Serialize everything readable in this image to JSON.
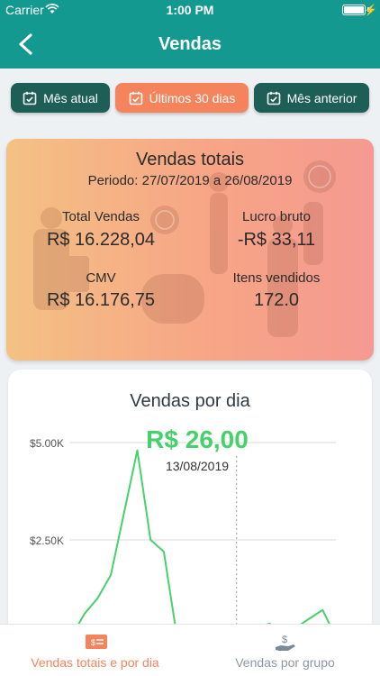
{
  "status_bar": {
    "carrier": "Carrier",
    "time": "1:00 PM"
  },
  "nav": {
    "title": "Vendas"
  },
  "filters": [
    {
      "label": "Mês atual",
      "active": false
    },
    {
      "label": "Últimos 30 dias",
      "active": true
    },
    {
      "label": "Mês anterior",
      "active": false
    }
  ],
  "summary": {
    "title": "Vendas totais",
    "period": "Periodo: 27/07/2019 a 26/08/2019",
    "total_vendas_label": "Total Vendas",
    "total_vendas_value": "R$ 16.228,04",
    "lucro_bruto_label": "Lucro bruto",
    "lucro_bruto_value": "-R$ 33,11",
    "cmv_label": "CMV",
    "cmv_value": "R$ 16.176,75",
    "itens_label": "Itens vendidos",
    "itens_value": "172.0"
  },
  "chart": {
    "title": "Vendas por dia",
    "highlight_value": "R$ 26,00",
    "highlight_date": "13/08/2019",
    "y_ticks": [
      "$5.00K",
      "$2.50K"
    ]
  },
  "chart_data": {
    "type": "line",
    "title": "Vendas por dia",
    "xlabel": "",
    "ylabel": "",
    "ylim": [
      0,
      6000
    ],
    "y_tick_values": [
      5000,
      2500
    ],
    "series": [
      {
        "values": [
          0,
          600,
          1000,
          1600,
          3200,
          4800,
          2500,
          2200,
          0,
          null,
          null,
          null,
          null,
          0,
          250,
          350,
          120,
          250,
          480,
          700,
          0
        ]
      }
    ],
    "highlight_index": 13,
    "grid": true,
    "line_color": "#47d16a"
  },
  "tabs": [
    {
      "label": "Vendas totais e por dia",
      "active": true
    },
    {
      "label": "Vendas por grupo",
      "active": false
    }
  ],
  "colors": {
    "header": "#13998f",
    "accent": "#f5845d",
    "filter_dark": "#1d5e56",
    "chart_line": "#47d16a"
  }
}
